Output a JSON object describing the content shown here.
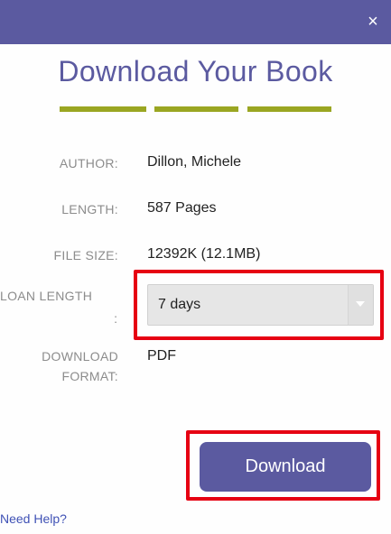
{
  "dialog": {
    "close_label": "×",
    "title": "Download Your Book",
    "author_label": "AUTHOR:",
    "author_value": "Dillon, Michele",
    "length_label": "LENGTH:",
    "length_value": "587 Pages",
    "filesize_label": "FILE SIZE:",
    "filesize_value": "12392K (12.1MB)",
    "loan_label": "LOAN LENGTH",
    "loan_label_colon": ":",
    "loan_value": "7 days",
    "format_label_line1": "DOWNLOAD",
    "format_label_line2": "FORMAT:",
    "format_value": "PDF",
    "download_label": "Download",
    "help_label": "Need Help?"
  },
  "colors": {
    "header": "#5b5aa0",
    "title": "#5b5aa0",
    "divider": "#9aa622",
    "highlight": "#e60012",
    "button": "#5b5aa0",
    "link": "#3f51b5"
  }
}
